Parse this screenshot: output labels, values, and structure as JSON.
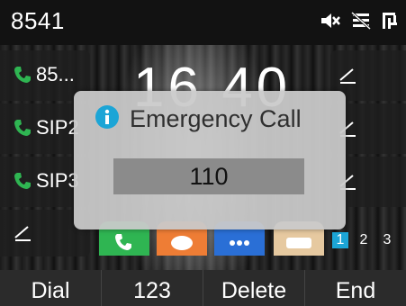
{
  "status_bar": {
    "extension": "8541",
    "icons": [
      "mute-icon",
      "no-network-icon",
      "network-icon"
    ]
  },
  "clock": {
    "time": "16 40"
  },
  "line_keys": [
    {
      "label": "85...",
      "icon": "phone-icon"
    },
    {
      "label": "SIP2",
      "icon": "phone-icon"
    },
    {
      "label": "SIP3",
      "icon": "phone-icon"
    }
  ],
  "dialog": {
    "icon": "info-icon",
    "title": "Emergency Call",
    "number": "110"
  },
  "pager": {
    "pages": [
      "1",
      "2",
      "3"
    ],
    "active": "1"
  },
  "softkeys": {
    "dial": "Dial",
    "mode": "123",
    "delete": "Delete",
    "end": "End"
  },
  "colors": {
    "accent": "#1ca5d6",
    "phone_green": "#2fb552",
    "dialog_bg": "#cacaca"
  }
}
